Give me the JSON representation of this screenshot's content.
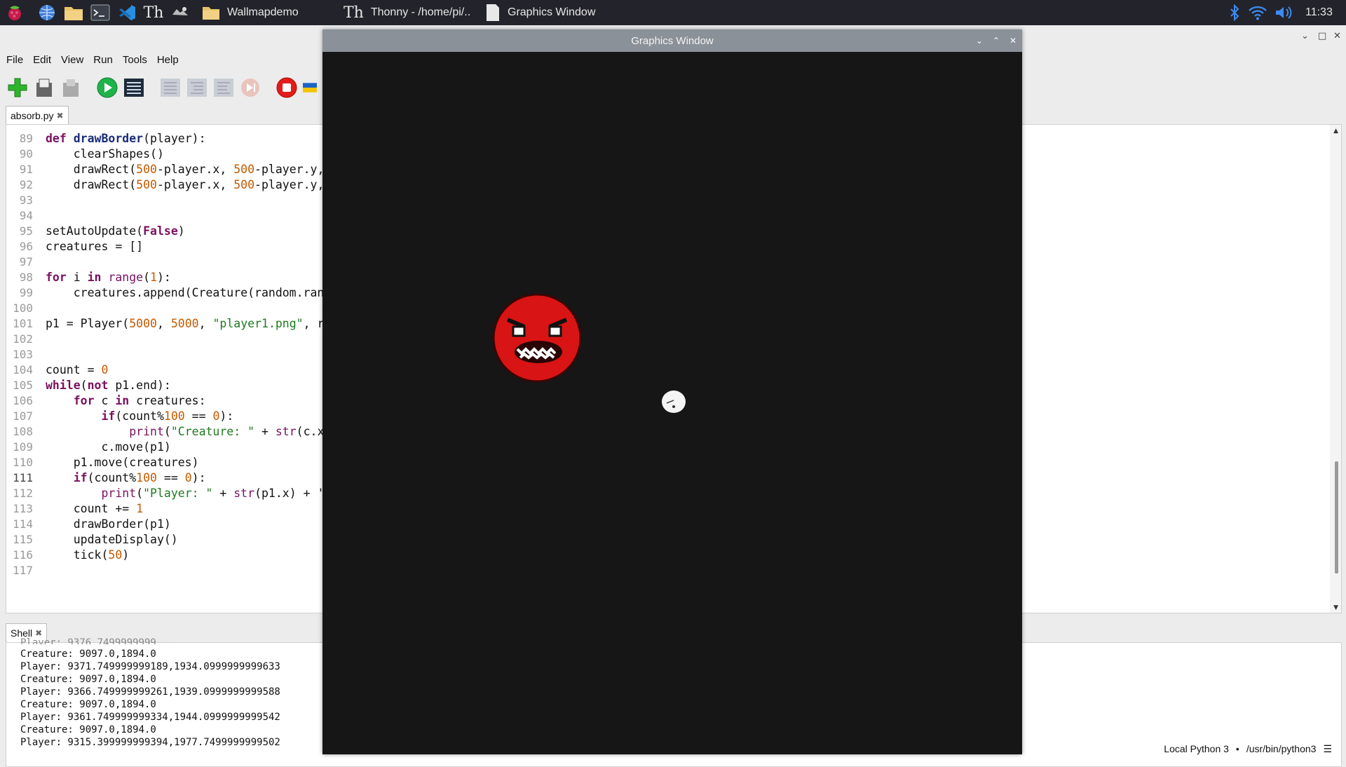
{
  "taskbar": {
    "tasks": [
      {
        "label": "Wallmapdemo"
      },
      {
        "label": "Thonny  -  /home/pi/.."
      },
      {
        "label": "Graphics Window"
      }
    ],
    "time": "11:33"
  },
  "menu": [
    "File",
    "Edit",
    "View",
    "Run",
    "Tools",
    "Help"
  ],
  "editor_tab": "absorb.py",
  "shell_tab": "Shell",
  "code_lines": [
    {
      "n": "89"
    },
    {
      "n": "90"
    },
    {
      "n": "91"
    },
    {
      "n": "92"
    },
    {
      "n": "93"
    },
    {
      "n": "94"
    },
    {
      "n": "95"
    },
    {
      "n": "96"
    },
    {
      "n": "97"
    },
    {
      "n": "98"
    },
    {
      "n": "99"
    },
    {
      "n": "100"
    },
    {
      "n": "101"
    },
    {
      "n": "102"
    },
    {
      "n": "103"
    },
    {
      "n": "104"
    },
    {
      "n": "105"
    },
    {
      "n": "106"
    },
    {
      "n": "107"
    },
    {
      "n": "108"
    },
    {
      "n": "109"
    },
    {
      "n": "110"
    },
    {
      "n": "111"
    },
    {
      "n": "112"
    },
    {
      "n": "113"
    },
    {
      "n": "114"
    },
    {
      "n": "115"
    },
    {
      "n": "116"
    },
    {
      "n": "117"
    }
  ],
  "code": {
    "l89a": "def",
    "l89b": " drawBorder",
    "l89c": "(player):",
    "l90": "    clearShapes()",
    "l91a": "    drawRect(",
    "l91b": "500",
    "l91c": "-player.x, ",
    "l91d": "500",
    "l91e": "-player.y,",
    "l92a": "    drawRect(",
    "l92b": "500",
    "l92c": "-player.x, ",
    "l92d": "500",
    "l92e": "-player.y,",
    "l95a": "setAutoUpdate(",
    "l95b": "False",
    "l95c": ")",
    "l96": "creatures = []",
    "l98a": "for",
    "l98b": " i ",
    "l98c": "in",
    "l98d": " ",
    "l98e": "range",
    "l98f": "(",
    "l98g": "1",
    "l98h": "):",
    "l99": "    creatures.append(Creature(random.ran",
    "l101a": "p1 = Player(",
    "l101b": "5000",
    "l101c": ", ",
    "l101d": "5000",
    "l101e": ", ",
    "l101f": "\"player1.png\"",
    "l101g": ", r",
    "l104a": "count = ",
    "l104b": "0",
    "l105a": "while",
    "l105b": "(",
    "l105c": "not",
    "l105d": " p1.end):",
    "l106a": "    ",
    "l106b": "for",
    "l106c": " c ",
    "l106d": "in",
    "l106e": " creatures:",
    "l107a": "        ",
    "l107b": "if",
    "l107c": "(count%",
    "l107d": "100",
    "l107e": " == ",
    "l107f": "0",
    "l107g": "):",
    "l108a": "            ",
    "l108b": "print",
    "l108c": "(",
    "l108d": "\"Creature: \"",
    "l108e": " + ",
    "l108f": "str",
    "l108g": "(c.x",
    "l109": "        c.move(p1)",
    "l110": "    p1.move(creatures)",
    "l111a": "    ",
    "l111b": "if",
    "l111c": "(count%",
    "l111d": "100",
    "l111e": " == ",
    "l111f": "0",
    "l111g": "):",
    "l112a": "        ",
    "l112b": "print",
    "l112c": "(",
    "l112d": "\"Player: \"",
    "l112e": " + ",
    "l112f": "str",
    "l112g": "(p1.x) + '",
    "l113a": "    count += ",
    "l113b": "1",
    "l114": "    drawBorder(p1)",
    "l115": "    updateDisplay()",
    "l116a": "    tick(",
    "l116b": "50",
    "l116c": ")"
  },
  "shell_lines": [
    "Creature: 9097.0,1894.0",
    "Player: 9371.749999999189,1934.0999999999633",
    "Creature: 9097.0,1894.0",
    "Player: 9366.749999999261,1939.0999999999588",
    "Creature: 9097.0,1894.0",
    "Player: 9361.749999999334,1944.0999999999542",
    "Creature: 9097.0,1894.0",
    "Player: 9315.399999999394,1977.7499999999502"
  ],
  "status": {
    "interpreter": "Local Python 3",
    "sep": "•",
    "path": "/usr/bin/python3"
  },
  "graphics_window": {
    "title": "Graphics Window"
  },
  "colors": {
    "taskbar": "#23232b",
    "gfx_bg": "#161616",
    "creature_red": "#d81414"
  }
}
